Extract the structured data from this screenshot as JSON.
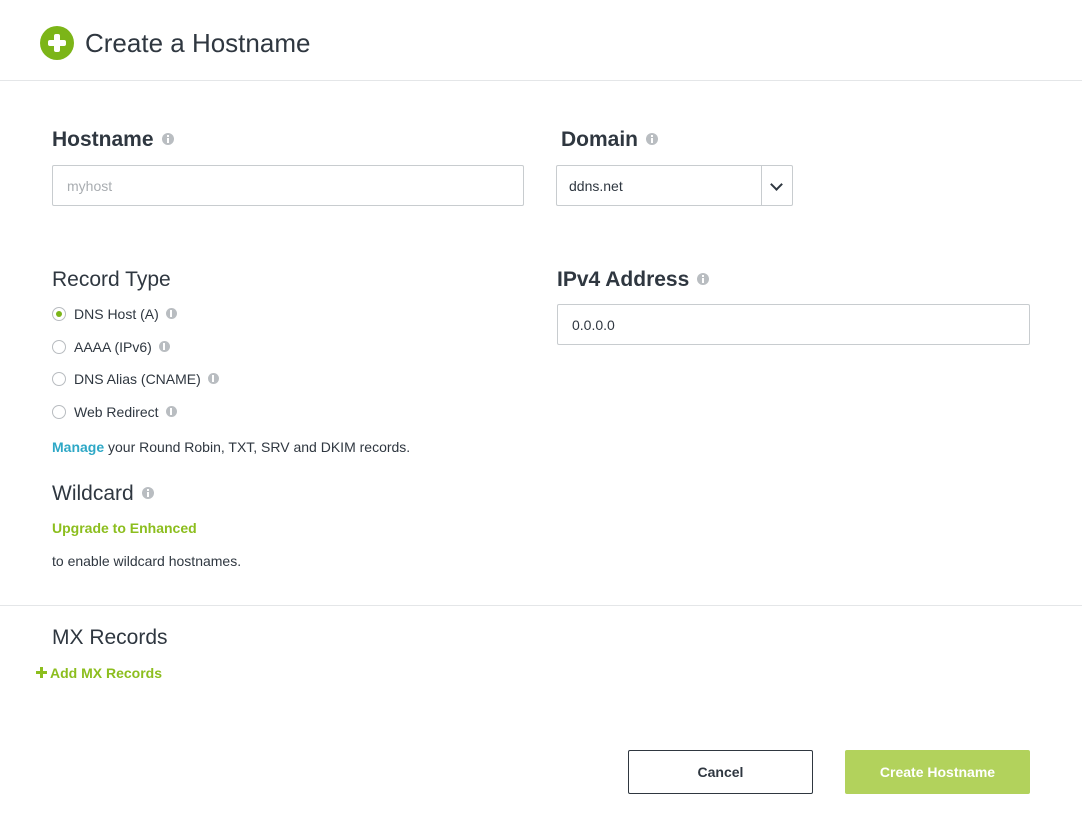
{
  "header": {
    "title": "Create a Hostname",
    "icon": "plus-circle-icon"
  },
  "hostname": {
    "label": "Hostname",
    "placeholder": "myhost",
    "value": ""
  },
  "domain": {
    "label": "Domain",
    "selected": "ddns.net"
  },
  "record_type": {
    "label": "Record Type",
    "options": [
      {
        "label": "DNS Host (A)",
        "checked": true
      },
      {
        "label": "AAAA (IPv6)",
        "checked": false
      },
      {
        "label": "DNS Alias (CNAME)",
        "checked": false
      },
      {
        "label": "Web Redirect",
        "checked": false
      }
    ],
    "manage_link": "Manage",
    "manage_text": " your Round Robin, TXT, SRV and DKIM records."
  },
  "ipv4": {
    "label": "IPv4 Address",
    "value": "0.0.0.0"
  },
  "wildcard": {
    "label": "Wildcard",
    "upgrade_link": "Upgrade to Enhanced",
    "note": "to enable wildcard hostnames."
  },
  "mx": {
    "label": "MX Records",
    "add_link": "Add MX Records"
  },
  "buttons": {
    "cancel": "Cancel",
    "create": "Create Hostname"
  },
  "colors": {
    "accent_green": "#7cb518",
    "link_green": "#8cbe1e",
    "link_blue": "#2ea8c6",
    "create_button": "#b2d25c",
    "text": "#2f3740"
  }
}
